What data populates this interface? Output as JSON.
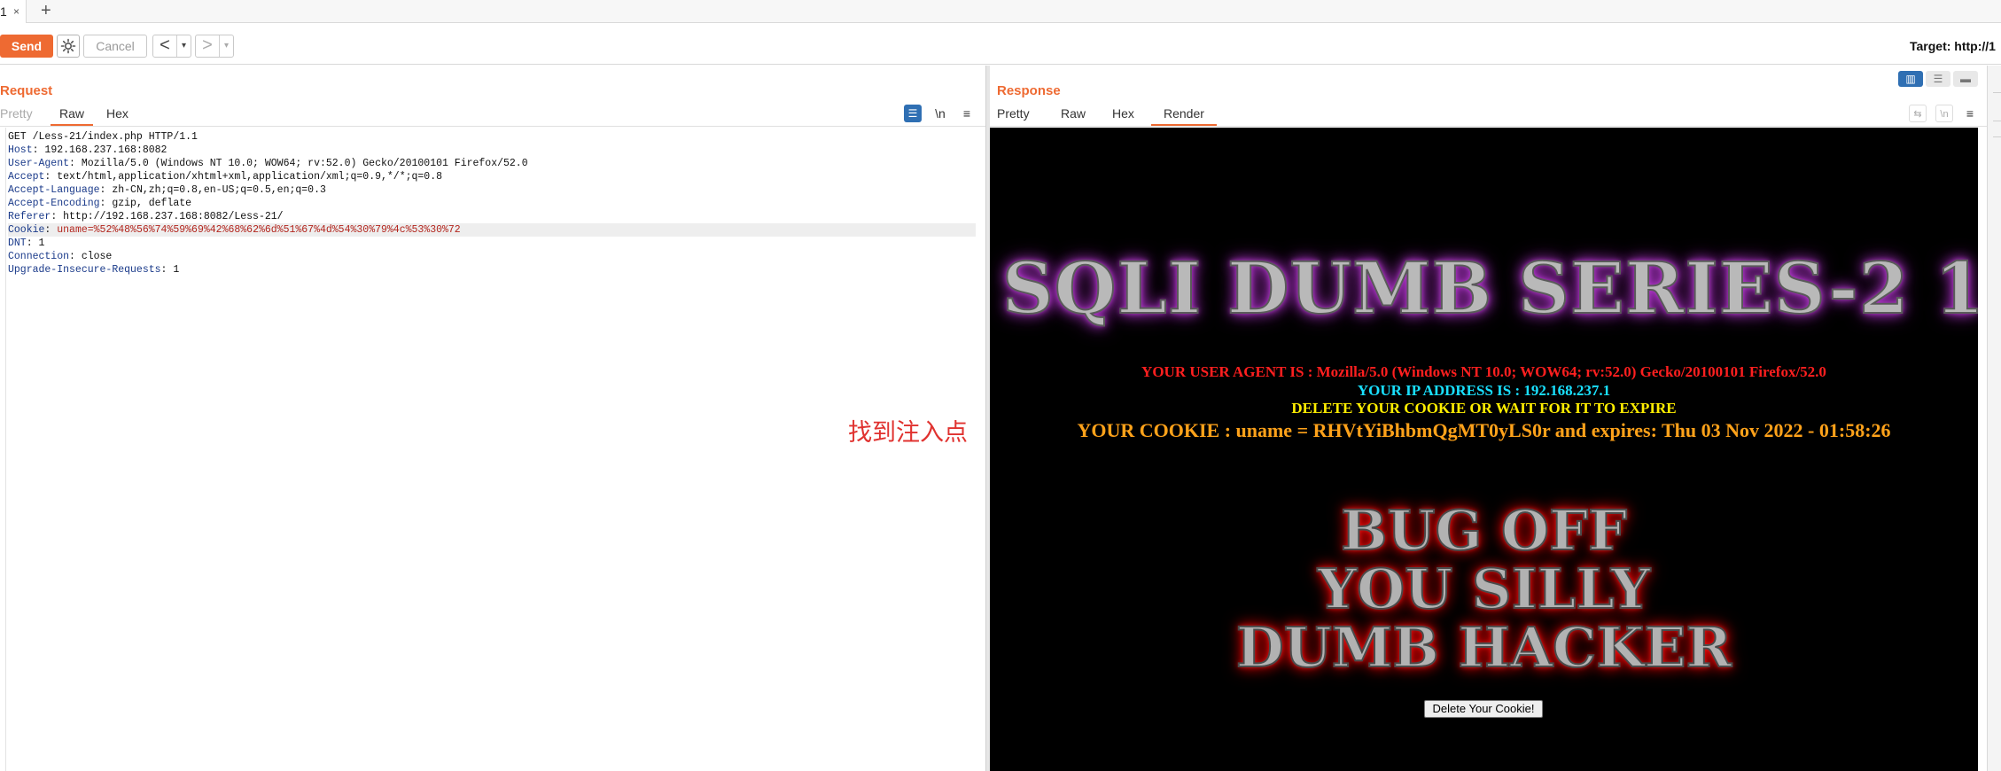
{
  "tabs": [
    {
      "label": "1",
      "close": "×"
    }
  ],
  "tab_add": "+",
  "toolbar": {
    "send_label": "Send",
    "cancel_label": "Cancel",
    "back_arrow": "<",
    "forward_arrow": ">",
    "dropdown_glyph": "▾",
    "target_text": "Target: http://1"
  },
  "request": {
    "title": "Request",
    "tabs": [
      "Pretty",
      "Raw",
      "Hex"
    ],
    "active_tab": "Raw",
    "tools": {
      "wrap_icon": "wrap-lines-icon",
      "newline": "\\n",
      "menu": "≡"
    },
    "lines": [
      {
        "key": "GET /Less-21/index.php HTTP/1.1",
        "value": ""
      },
      {
        "key": "Host",
        "value": "192.168.237.168:8082"
      },
      {
        "key": "User-Agent",
        "value": "Mozilla/5.0 (Windows NT 10.0; WOW64; rv:52.0) Gecko/20100101 Firefox/52.0"
      },
      {
        "key": "Accept",
        "value": "text/html,application/xhtml+xml,application/xml;q=0.9,*/*;q=0.8"
      },
      {
        "key": "Accept-Language",
        "value": "zh-CN,zh;q=0.8,en-US;q=0.5,en;q=0.3"
      },
      {
        "key": "Accept-Encoding",
        "value": "gzip, deflate"
      },
      {
        "key": "Referer",
        "value": "http://192.168.237.168:8082/Less-21/"
      },
      {
        "key": "Cookie",
        "value": "uname=%52%48%56%74%59%69%42%68%62%6d%51%67%4d%54%30%79%4c%53%30%72"
      },
      {
        "key": "DNT",
        "value": "1"
      },
      {
        "key": "Connection",
        "value": "close"
      },
      {
        "key": "Upgrade-Insecure-Requests",
        "value": "1"
      }
    ],
    "annotation": "找到注入点"
  },
  "response": {
    "title": "Response",
    "tabs": [
      "Pretty",
      "Raw",
      "Hex",
      "Render"
    ],
    "active_tab": "Render",
    "tools": {
      "wrap": "⇆",
      "newline": "\\n",
      "menu": "≡"
    },
    "render": {
      "banner": "SQLI DUMB SERIES-2 1",
      "user_agent_line": "YOUR USER AGENT IS : Mozilla/5.0 (Windows NT 10.0; WOW64; rv:52.0) Gecko/20100101 Firefox/52.0",
      "ip_line": "YOUR IP ADDRESS IS : 192.168.237.1",
      "delete_line": "DELETE YOUR COOKIE OR WAIT FOR IT TO EXPIRE",
      "cookie_line": "YOUR COOKIE : uname = RHVtYiBhbmQgMT0yLS0r and expires: Thu 03 Nov 2022 - 01:58:26",
      "bug_lines": [
        "BUG OFF",
        "YOU SILLY",
        "DUMB HACKER"
      ],
      "delete_button": "Delete Your Cookie!"
    }
  },
  "colors": {
    "accent": "#ee6a32",
    "blue": "#2f6fb3",
    "annotation": "#e0322f"
  }
}
